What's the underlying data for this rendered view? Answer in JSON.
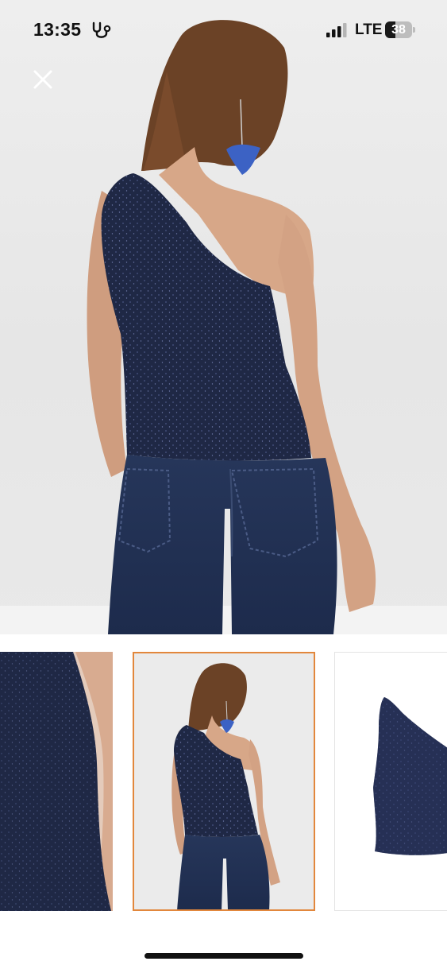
{
  "status_bar": {
    "time": "13:35",
    "health_icon": "stethoscope-icon",
    "signal_icon": "cellular-signal-icon",
    "network": "LTE",
    "battery_level": "38",
    "battery_fraction": 0.38
  },
  "close_icon": "close-icon",
  "gallery": {
    "main_image": "product-photo-back-view",
    "thumbnails": [
      {
        "name": "thumbnail-fabric-closeup",
        "selected": false
      },
      {
        "name": "thumbnail-back-view",
        "selected": true
      },
      {
        "name": "thumbnail-product-flat",
        "selected": false
      }
    ],
    "selected_border_color": "#e2873c"
  },
  "colors": {
    "sequin_navy": "#1e2746",
    "denim": "#243458",
    "wall": "#e8e8e8"
  }
}
